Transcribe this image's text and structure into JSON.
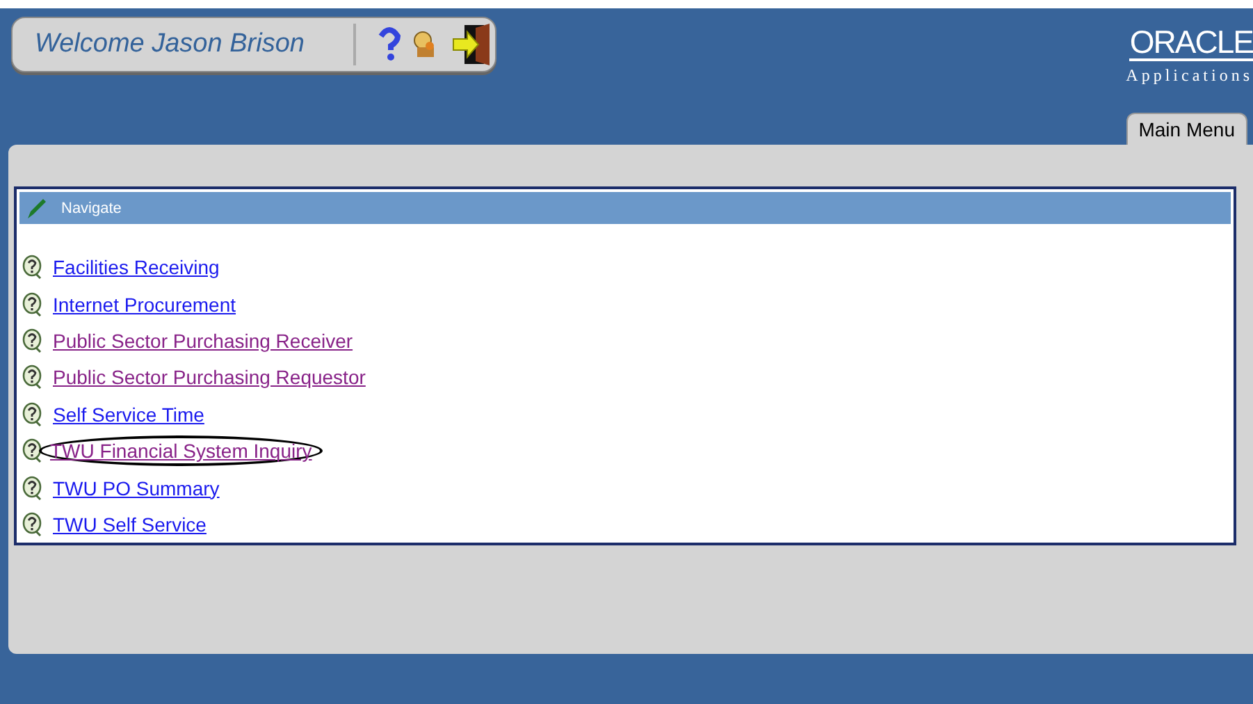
{
  "header": {
    "welcome": "Welcome Jason Brison",
    "logo": {
      "brand": "ORACLE",
      "product": "Applications"
    }
  },
  "tabs": [
    {
      "label": "Main Menu",
      "selected": true
    }
  ],
  "navigate": {
    "title": "Navigate",
    "items": [
      {
        "label": "Facilities Receiving",
        "visited": false,
        "circled": false
      },
      {
        "label": "Internet Procurement",
        "visited": false,
        "circled": false
      },
      {
        "label": "Public Sector Purchasing Receiver",
        "visited": true,
        "circled": false
      },
      {
        "label": "Public Sector Purchasing Requestor",
        "visited": true,
        "circled": false
      },
      {
        "label": "Self Service Time",
        "visited": false,
        "circled": false
      },
      {
        "label": "TWU Financial System Inquiry",
        "visited": true,
        "circled": true
      },
      {
        "label": "TWU PO Summary",
        "visited": false,
        "circled": false
      },
      {
        "label": "TWU Self Service",
        "visited": false,
        "circled": false
      }
    ]
  }
}
